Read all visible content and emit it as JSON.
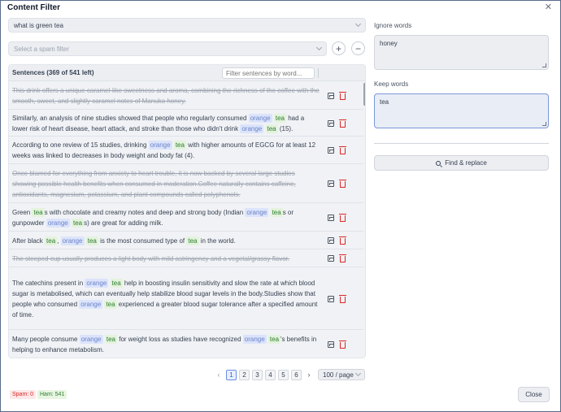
{
  "window": {
    "title": "Content Filter",
    "close_glyph": "✕"
  },
  "query": {
    "value": "what is green tea"
  },
  "spam_filter": {
    "placeholder": "Select a spam filter",
    "add_glyph": "+",
    "remove_glyph": "−"
  },
  "table": {
    "header": "Sentences (369 of 541 left)",
    "filter_placeholder": "Filter sentences by word..."
  },
  "rows": [
    {
      "spam": true,
      "segments": [
        {
          "t": "This drink offers a unique caramel-like sweetness and aroma, combining the richness of the coffee with the smooth, sweet, and slightly caramel notes of Manuka honey."
        }
      ]
    },
    {
      "spam": false,
      "segments": [
        {
          "t": "Similarly, an analysis of nine studies showed that people who regularly consumed "
        },
        {
          "t": "orange",
          "k": "o"
        },
        {
          "t": " "
        },
        {
          "t": "tea",
          "k": "t"
        },
        {
          "t": " had a lower risk of heart disease, heart attack, and stroke than those who didn't drink "
        },
        {
          "t": "orange",
          "k": "o"
        },
        {
          "t": " "
        },
        {
          "t": "tea",
          "k": "t"
        },
        {
          "t": " (15)."
        }
      ]
    },
    {
      "spam": false,
      "segments": [
        {
          "t": "According to one review of 15 studies, drinking "
        },
        {
          "t": "orange",
          "k": "o"
        },
        {
          "t": " "
        },
        {
          "t": "tea",
          "k": "t"
        },
        {
          "t": " with higher amounts of EGCG for at least 12 weeks was linked to decreases in body weight and body fat (4)."
        }
      ]
    },
    {
      "spam": true,
      "segments": [
        {
          "t": "Once blamed for everything from anxiety to heart trouble, it is now backed by several large studies showing possible health benefits when consumed in moderation.Coffee naturally contains caffeine, antioxidants, magnesium, potassium, and plant compounds called polyphenols."
        }
      ]
    },
    {
      "spam": false,
      "segments": [
        {
          "t": "Green "
        },
        {
          "t": "tea",
          "k": "t"
        },
        {
          "t": "s with chocolate and creamy notes and deep and strong body (Indian "
        },
        {
          "t": "orange",
          "k": "o"
        },
        {
          "t": " "
        },
        {
          "t": "tea",
          "k": "t"
        },
        {
          "t": "s or gunpowder "
        },
        {
          "t": "orange",
          "k": "o"
        },
        {
          "t": " "
        },
        {
          "t": "tea",
          "k": "t"
        },
        {
          "t": "s) are great for adding milk."
        }
      ]
    },
    {
      "spam": false,
      "segments": [
        {
          "t": "After black "
        },
        {
          "t": "tea",
          "k": "t"
        },
        {
          "t": ", "
        },
        {
          "t": "orange",
          "k": "o"
        },
        {
          "t": " "
        },
        {
          "t": "tea",
          "k": "t"
        },
        {
          "t": " is the most consumed type of "
        },
        {
          "t": "tea",
          "k": "t"
        },
        {
          "t": " in the world."
        }
      ]
    },
    {
      "spam": true,
      "segments": [
        {
          "t": "The steeped cup usually produces a light body with mild astringency and a vegetal/grassy flavor."
        }
      ]
    },
    {
      "spam": false,
      "segments": [
        {
          "t": "The catechins present in "
        },
        {
          "t": "orange",
          "k": "o"
        },
        {
          "t": " "
        },
        {
          "t": "tea",
          "k": "t"
        },
        {
          "t": " help in boosting insulin sensitivity and slow the rate at which blood sugar is metabolised, which can eventually help stabilize blood sugar levels in the body.Studies show that people who consumed "
        },
        {
          "t": "orange",
          "k": "o"
        },
        {
          "t": " "
        },
        {
          "t": "tea",
          "k": "t"
        },
        {
          "t": " experienced a greater blood sugar tolerance after a specified amount of time."
        }
      ]
    },
    {
      "spam": false,
      "segments": [
        {
          "t": "Many people consume "
        },
        {
          "t": "orange",
          "k": "o"
        },
        {
          "t": " "
        },
        {
          "t": "tea",
          "k": "t"
        },
        {
          "t": " for weight loss as studies have recognized "
        },
        {
          "t": "orange",
          "k": "o"
        },
        {
          "t": " "
        },
        {
          "t": "tea",
          "k": "t"
        },
        {
          "t": "'s benefits in helping to enhance metabolism."
        }
      ]
    }
  ],
  "pagination": {
    "prev_glyph": "‹",
    "next_glyph": "›",
    "pages": [
      "1",
      "2",
      "3",
      "4",
      "5",
      "6"
    ],
    "current": "1",
    "per_page": "100 / page"
  },
  "ignore_words": {
    "label": "Ignore words",
    "value": "honey"
  },
  "keep_words": {
    "label": "Keep words",
    "value": "tea"
  },
  "find_replace": {
    "label": "Find & replace"
  },
  "footer": {
    "spam_count": "Spam: 0",
    "ham_count": "Ham: 541",
    "close_label": "Close"
  },
  "colors": {
    "accent": "#6b8de3",
    "danger": "#dc2626",
    "keep_token": "#2e7d32",
    "replace_token": "#6b82c9"
  }
}
